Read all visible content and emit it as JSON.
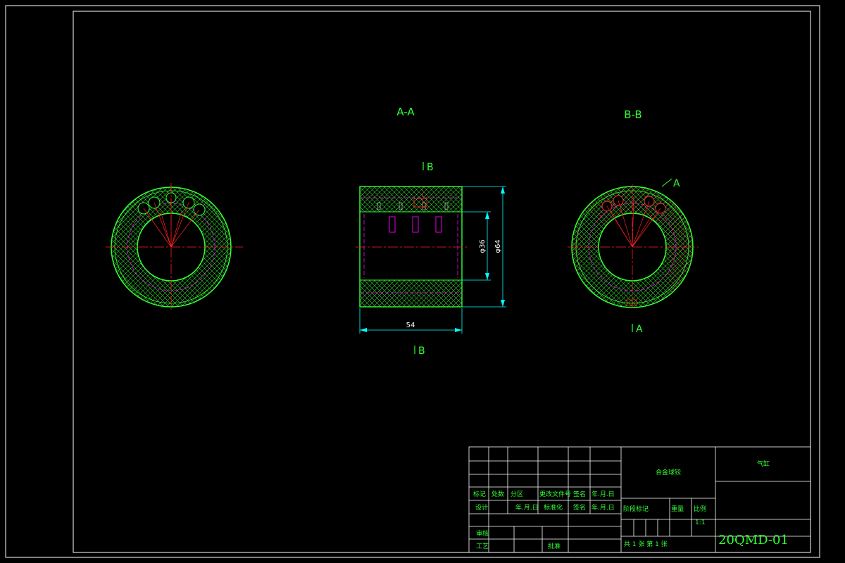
{
  "colors": {
    "background": "#000000",
    "frame": "#ffffff",
    "outline": "#33ff33",
    "hatch": "#33cc33",
    "center_line": "#ff2020",
    "hidden": "#ff00ff",
    "dimension": "#00ffff",
    "section_hatch": "#ff3333"
  },
  "views": {
    "aa_title": "A-A",
    "bb_title": "B-B",
    "cut_b_top": "B",
    "cut_b_bottom": "B",
    "cut_a_top": "A",
    "cut_a_bottom": "A"
  },
  "dimensions": {
    "length": "54",
    "inner_dia": "φ36",
    "outer_dia": "φ64"
  },
  "title_block": {
    "part_name": "合金球铰",
    "material": "气缸",
    "drawing_no": "20QMD-01",
    "row_labels": {
      "mark": "标记",
      "count": "处数",
      "zone": "分区",
      "change_doc": "更改文件号",
      "sign": "签名",
      "date": "年.月.日"
    },
    "design": "设计",
    "std": "标准化",
    "sign2": "签名",
    "date2": "年.月.日",
    "date_design": "年.月.日",
    "review": "审核",
    "process": "工艺",
    "approve": "批准",
    "stage_mark": "阶段标记",
    "weight": "重量",
    "scale": "比例",
    "scale_value": "1:1",
    "sheets": "共 1 张  第 1 张"
  }
}
